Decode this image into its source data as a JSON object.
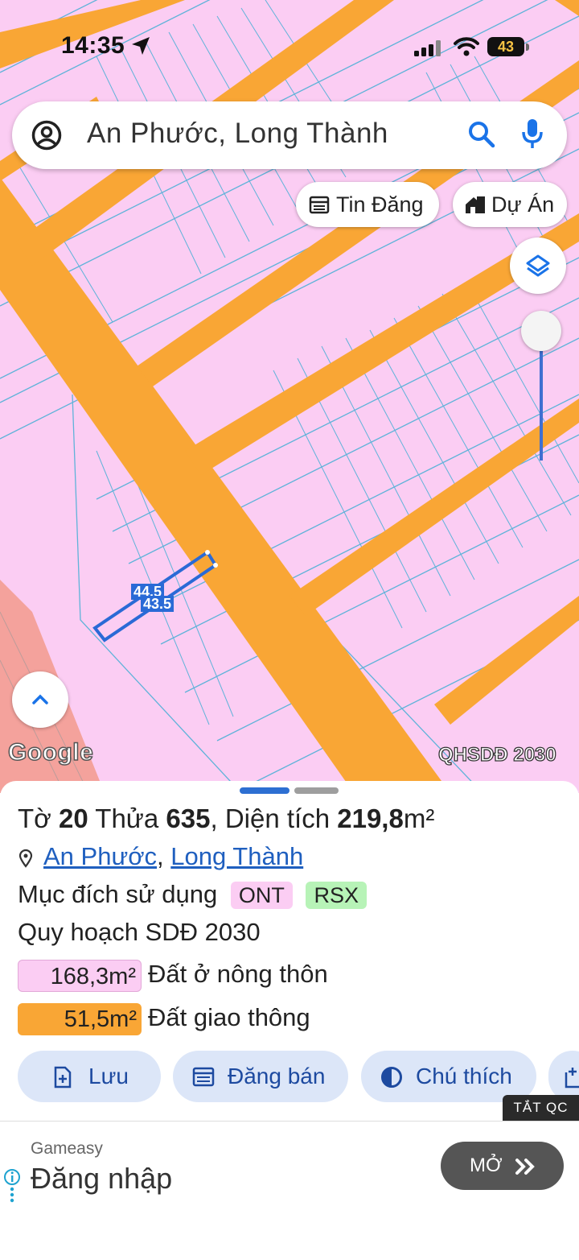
{
  "status_bar": {
    "time": "14:35",
    "battery": "43"
  },
  "search": {
    "query": "An Phước, Long Thành"
  },
  "chips": {
    "tin_dang": "Tin Đăng",
    "du_an": "Dự Án"
  },
  "map": {
    "attribution": "Google",
    "layer_label": "QHSDĐ 2030",
    "measure_1": "44.5",
    "measure_2": "43.5",
    "colors": {
      "rural_land": "#fbcdf3",
      "road": "#f9a635",
      "parcel_line": "#5fb3d9",
      "selection": "#2a6ad6",
      "edge_zone": "#f4a29c"
    }
  },
  "sheet": {
    "title": {
      "to_label": "Tờ",
      "to_value": "20",
      "thua_label": "Thửa",
      "thua_value": "635",
      "dien_tich_label": "Diện tích",
      "dien_tich_value": "219,8",
      "unit": "m²"
    },
    "address": {
      "ward": "An Phước",
      "sep": ",",
      "district": "Long Thành"
    },
    "purpose": {
      "label": "Mục đích sử dụng",
      "tags": [
        "ONT",
        "RSX"
      ]
    },
    "plan_label": "Quy hoạch SDĐ 2030",
    "areas": [
      {
        "value": "168,3m²",
        "label": "Đất ở nông thôn"
      },
      {
        "value": "51,5m²",
        "label": "Đất giao thông"
      }
    ],
    "actions": {
      "save": "Lưu",
      "post": "Đăng bán",
      "legend": "Chú thích"
    }
  },
  "ad": {
    "close_label": "TẮT QC",
    "brand": "Gameasy",
    "headline": "Đăng nhập",
    "cta": "MỞ"
  }
}
